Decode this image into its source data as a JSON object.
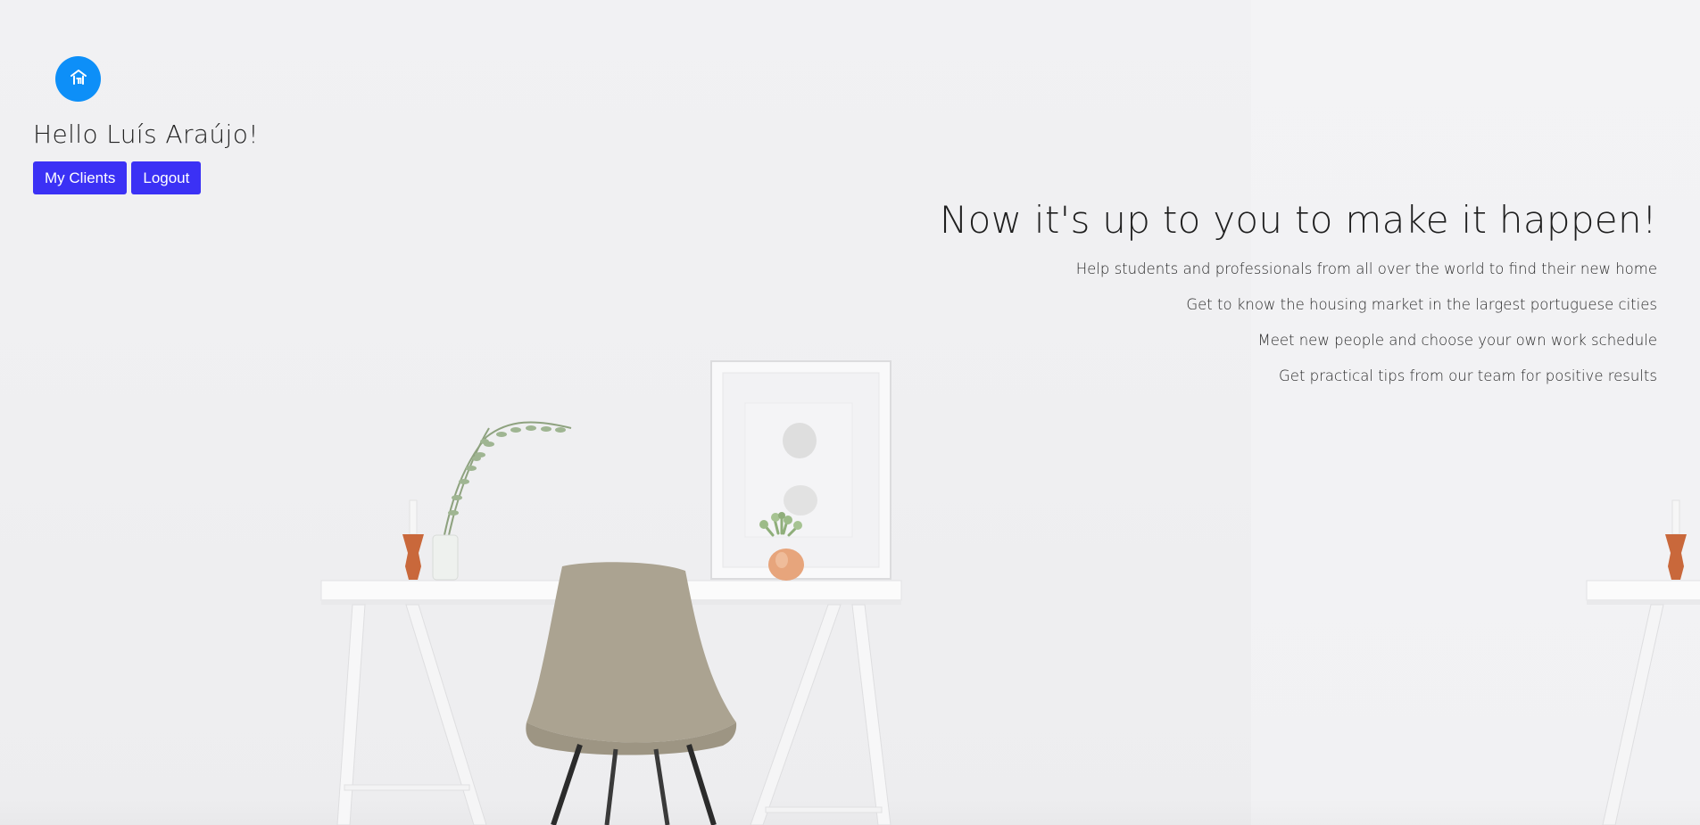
{
  "header": {
    "logo_icon": "home-icon",
    "logo_color": "#0d8ff8",
    "greeting": "Hello Luís Araújo!",
    "buttons": {
      "my_clients": "My Clients",
      "logout": "Logout"
    },
    "button_color": "#3b31f5"
  },
  "hero": {
    "title": "Now it's up to you to make it happen!",
    "bullets": [
      "Help students and professionals from all over the world to find their new home",
      "Get to know the housing market in the largest portuguese cities",
      "Meet new people and choose your own work schedule",
      "Get practical tips from our team for positive results"
    ]
  }
}
